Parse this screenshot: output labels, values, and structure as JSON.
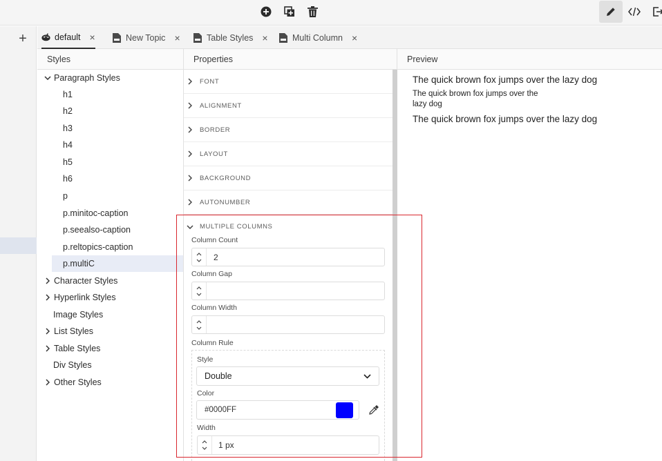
{
  "toolbar": {
    "add_icon": "plus-circle-icon",
    "duplicate_icon": "duplicate-icon",
    "delete_icon": "trash-icon",
    "right_icons": [
      "pencil-icon",
      "code-icon",
      "exit-icon"
    ]
  },
  "rail": {
    "add_label": "+"
  },
  "tabs": [
    {
      "label": "default",
      "icon": "palette-icon",
      "close": "×"
    },
    {
      "label": "New Topic",
      "icon": "document-icon",
      "close": "×"
    },
    {
      "label": "Table Styles",
      "icon": "document-icon",
      "close": "×"
    },
    {
      "label": "Multi Column",
      "icon": "document-icon",
      "close": "×"
    }
  ],
  "panels": {
    "styles": "Styles",
    "properties": "Properties",
    "preview": "Preview"
  },
  "tree": {
    "paragraph": "Paragraph Styles",
    "children": [
      "h1",
      "h2",
      "h3",
      "h4",
      "h5",
      "h6",
      "p",
      "p.minitoc-caption",
      "p.seealso-caption",
      "p.reltopics-caption",
      "p.multiC"
    ],
    "groups": [
      "Character Styles",
      "Hyperlink Styles",
      "Image Styles",
      "List Styles",
      "Table Styles",
      "Div Styles",
      "Other Styles"
    ]
  },
  "properties": {
    "sections": [
      "FONT",
      "ALIGNMENT",
      "BORDER",
      "LAYOUT",
      "BACKGROUND",
      "AUTONUMBER"
    ],
    "multi": "MULTIPLE COLUMNS",
    "column_count_label": "Column Count",
    "column_count": "2",
    "column_gap_label": "Column Gap",
    "column_gap": "",
    "column_width_label": "Column Width",
    "column_width": "",
    "column_rule_label": "Column Rule",
    "style_label": "Style",
    "style_value": "Double",
    "color_label": "Color",
    "color_value": "#0000FF",
    "width_label": "Width",
    "width_value": "1 px"
  },
  "preview": {
    "line1": "The quick brown fox jumps over the lazy dog",
    "line2a": "The quick brown fox jumps over the",
    "line2b": "lazy dog",
    "line3": "The quick brown fox jumps over the lazy dog"
  },
  "colors": {
    "swatch": "#0000FF",
    "highlight": "#D9262E",
    "selection": "#E8ECF6"
  }
}
